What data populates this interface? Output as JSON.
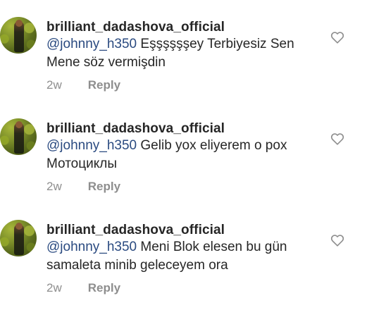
{
  "comments": [
    {
      "username": "brilliant_dadashova_official",
      "mention": "@johnny_h350",
      "text_line1": "Eşşşşşşey Terbiyesiz Sen",
      "text_line2": "Mene söz vermişdin",
      "time": "2w",
      "reply_label": "Reply",
      "avatar_icon": "profile-avatar",
      "like_icon": "heart-outline-icon"
    },
    {
      "username": "brilliant_dadashova_official",
      "mention": "@johnny_h350",
      "text_line1": "Gelib yox eliyerem o pox",
      "text_line2": "Мотоциклы",
      "time": "2w",
      "reply_label": "Reply",
      "avatar_icon": "profile-avatar",
      "like_icon": "heart-outline-icon"
    },
    {
      "username": "brilliant_dadashova_official",
      "mention": "@johnny_h350",
      "text_line1": "Meni Blok elesen bu gün",
      "text_line2": "samaleta minib geleceyem ora",
      "time": "2w",
      "reply_label": "Reply",
      "avatar_icon": "profile-avatar",
      "like_icon": "heart-outline-icon"
    }
  ],
  "colors": {
    "text": "#262626",
    "mention": "#2a4a80",
    "meta": "#8e8e8e",
    "icon": "#8e8e8e",
    "background": "#ffffff"
  }
}
